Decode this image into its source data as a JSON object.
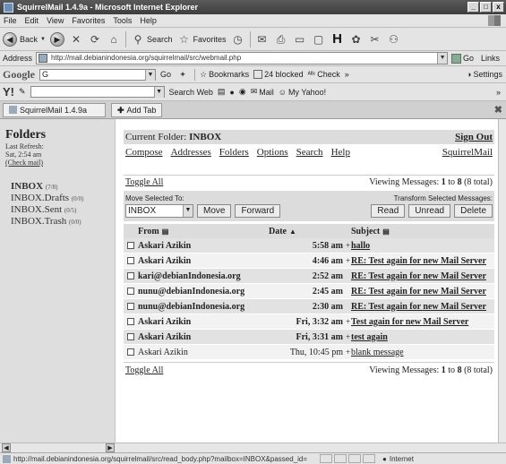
{
  "window": {
    "title": "SquirrelMail 1.4.9a - Microsoft Internet Explorer",
    "controls": [
      "_",
      "□",
      "x"
    ]
  },
  "menu": [
    "File",
    "Edit",
    "View",
    "Favorites",
    "Tools",
    "Help"
  ],
  "toolbar": {
    "back": "Back",
    "search": "Search",
    "favorites": "Favorites"
  },
  "address": {
    "label": "Address",
    "url": "http://mail.debianindonesia.org/squirrelmail/src/webmail.php",
    "go": "Go",
    "links": "Links"
  },
  "google_bar": {
    "brand": "Google",
    "field_prefix": "G",
    "go": "Go",
    "bookmarks": "Bookmarks",
    "blocked": "24 blocked",
    "check": "Check",
    "settings": "Settings"
  },
  "yahoo_bar": {
    "brand": "Y!",
    "search_web": "Search Web",
    "mail": "Mail",
    "my_yahoo": "My Yahoo!"
  },
  "tabs": {
    "active": "SquirrelMail 1.4.9a",
    "add": "Add Tab"
  },
  "sidebar": {
    "title": "Folders",
    "last_refresh_label": "Last Refresh:",
    "last_refresh_time": "Sat, 2:54 am",
    "check_mail": "(Check mail)",
    "folders": [
      {
        "name": "INBOX",
        "count": "(7/8)",
        "bold": true
      },
      {
        "name": "INBOX.Drafts",
        "count": "(0/0)",
        "bold": false
      },
      {
        "name": "INBOX.Sent",
        "count": "(0/5)",
        "bold": false
      },
      {
        "name": "INBOX.Trash",
        "count": "(0/0)",
        "bold": false
      }
    ]
  },
  "main": {
    "current_folder_label": "Current Folder:",
    "current_folder": "INBOX",
    "sign_out": "Sign Out",
    "nav": [
      "Compose",
      "Addresses",
      "Folders",
      "Options",
      "Search",
      "Help"
    ],
    "brand_link": "SquirrelMail",
    "toggle_all": "Toggle All",
    "viewing": {
      "prefix": "Viewing Messages:",
      "from": "1",
      "to_word": "to",
      "to": "8",
      "total": "(8 total)"
    },
    "move_label": "Move Selected To:",
    "move_select": "INBOX",
    "move_btn": "Move",
    "forward_btn": "Forward",
    "transform_label": "Transform Selected Messages:",
    "read_btn": "Read",
    "unread_btn": "Unread",
    "delete_btn": "Delete",
    "columns": {
      "from": "From",
      "date": "Date",
      "subject": "Subject"
    },
    "messages": [
      {
        "from": "Askari Azikin",
        "date": "5:58 am",
        "flag": "+",
        "subject": "hallo",
        "unread": true
      },
      {
        "from": "Askari Azikin",
        "date": "4:46 am",
        "flag": "+",
        "subject": "RE: Test again for new Mail Server",
        "unread": true
      },
      {
        "from": "kari@debianIndonesia.org",
        "date": "2:52 am",
        "flag": "",
        "subject": "RE: Test again for new Mail Server",
        "unread": true
      },
      {
        "from": "nunu@debianIndonesia.org",
        "date": "2:45 am",
        "flag": "",
        "subject": "RE: Test again for new Mail Server",
        "unread": true
      },
      {
        "from": "nunu@debianIndonesia.org",
        "date": "2:30 am",
        "flag": "",
        "subject": "RE: Test again for new Mail Server",
        "unread": true
      },
      {
        "from": "Askari Azikin",
        "date": "Fri, 3:32 am",
        "flag": "+",
        "subject": "Test again for new Mail Server",
        "unread": true
      },
      {
        "from": "Askari Azikin",
        "date": "Fri, 3:31 am",
        "flag": "+",
        "subject": "test again",
        "unread": true
      },
      {
        "from": "Askari Azikin",
        "date": "Thu, 10:45 pm",
        "flag": "+",
        "subject": "blank message",
        "unread": false
      }
    ]
  },
  "status": {
    "url": "http://mail.debianindonesia.org/squirrelmail/src/read_body.php?mailbox=INBOX&passed_id=",
    "zone": "Internet"
  }
}
